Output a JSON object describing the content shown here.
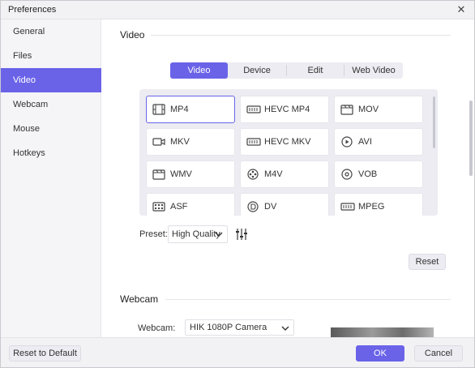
{
  "window": {
    "title": "Preferences"
  },
  "sidebar": {
    "items": [
      {
        "label": "General"
      },
      {
        "label": "Files"
      },
      {
        "label": "Video",
        "active": true
      },
      {
        "label": "Webcam"
      },
      {
        "label": "Mouse"
      },
      {
        "label": "Hotkeys"
      }
    ]
  },
  "video_section": {
    "title": "Video",
    "tabs": [
      {
        "label": "Video",
        "active": true
      },
      {
        "label": "Device"
      },
      {
        "label": "Edit"
      },
      {
        "label": "Web Video"
      }
    ],
    "formats": [
      {
        "label": "MP4",
        "icon": "film-icon",
        "selected": true
      },
      {
        "label": "HEVC MP4",
        "icon": "hevc-icon"
      },
      {
        "label": "MOV",
        "icon": "clapper-icon"
      },
      {
        "label": "MKV",
        "icon": "video-camera-icon"
      },
      {
        "label": "HEVC MKV",
        "icon": "hevc-icon"
      },
      {
        "label": "AVI",
        "icon": "play-circle-icon"
      },
      {
        "label": "WMV",
        "icon": "clapper-icon"
      },
      {
        "label": "M4V",
        "icon": "reel-icon"
      },
      {
        "label": "VOB",
        "icon": "disc-icon"
      },
      {
        "label": "ASF",
        "icon": "film-strip-icon"
      },
      {
        "label": "DV",
        "icon": "dv-icon"
      },
      {
        "label": "MPEG",
        "icon": "mpeg-icon"
      }
    ],
    "preset": {
      "label": "Preset:",
      "value": "High Quality"
    },
    "reset_label": "Reset"
  },
  "webcam_section": {
    "title": "Webcam",
    "field_label": "Webcam:",
    "value": "HIK 1080P Camera"
  },
  "footer": {
    "reset_default_label": "Reset to Default",
    "ok_label": "OK",
    "cancel_label": "Cancel"
  },
  "colors": {
    "accent": "#6a63e8",
    "panel": "#ececf2",
    "sidebar": "#f5f5f8"
  }
}
